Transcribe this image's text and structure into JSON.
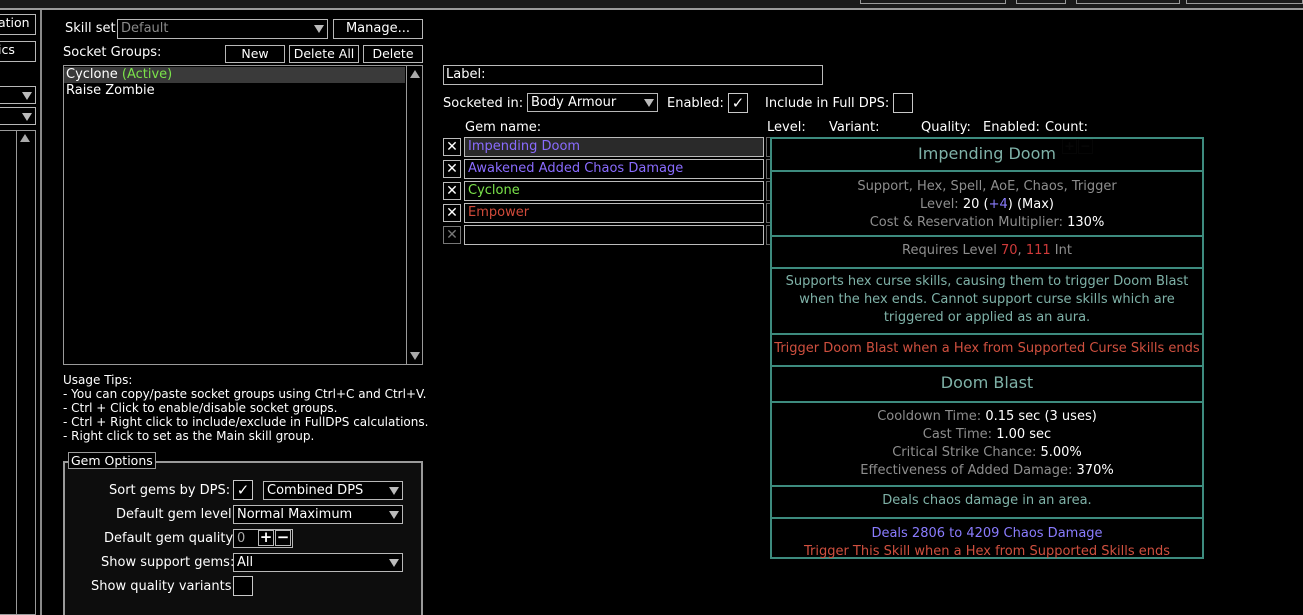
{
  "left_partial": {
    "items": [
      "ation",
      "ics"
    ]
  },
  "skill_set": {
    "label": "Skill set:",
    "value": "Default",
    "manage_button": "Manage..."
  },
  "socket_groups": {
    "label": "Socket Groups:",
    "new_button": "New",
    "delete_all_button": "Delete All",
    "delete_button": "Delete",
    "groups": [
      {
        "name": "Cyclone",
        "status": "(Active)"
      },
      {
        "name": "Raise Zombie",
        "status": ""
      }
    ]
  },
  "usage_tips": {
    "title": "Usage Tips:",
    "lines": [
      "- You can copy/paste socket groups using Ctrl+C and Ctrl+V.",
      "- Ctrl + Click to enable/disable socket groups.",
      "- Ctrl + Right click to include/exclude in FullDPS calculations.",
      "- Right click to set as the Main skill group."
    ]
  },
  "gem_options": {
    "title": "Gem Options",
    "sort_label": "Sort gems by DPS:",
    "sort_checked": "✓",
    "sort_mode": "Combined DPS",
    "default_level_label": "Default gem level:",
    "default_level": "Normal Maximum",
    "default_quality_label": "Default gem quality:",
    "default_quality": "0",
    "show_support_label": "Show support gems:",
    "show_support": "All",
    "show_quality_label": "Show quality variants:"
  },
  "group_editor": {
    "label_field": "Label:",
    "socketed_in_label": "Socketed in:",
    "socketed_in": "Body Armour",
    "enabled_label": "Enabled:",
    "enabled_checked": "✓",
    "full_dps_label": "Include in Full DPS:",
    "col_gem_name": "Gem name:",
    "col_level": "Level:",
    "col_variant": "Variant:",
    "col_quality": "Quality:",
    "col_enabled": "Enabled:",
    "col_count": "Count:",
    "gems": [
      {
        "name": "Impending Doom",
        "color": "#8a6cff"
      },
      {
        "name": "Awakened Added Chaos Damage",
        "color": "#8a6cff"
      },
      {
        "name": "Cyclone",
        "color": "#7be34a"
      },
      {
        "name": "Empower",
        "color": "#d04a3a"
      },
      {
        "name": "",
        "color": "#ffffff"
      }
    ]
  },
  "tooltip": {
    "gem_name": "Impending Doom",
    "tags": "Support, Hex, Spell, AoE, Chaos, Trigger",
    "level_label": "Level:",
    "level_value": "20",
    "level_bonus": "+4",
    "level_max": "(Max)",
    "cost_label": "Cost & Reservation Multiplier:",
    "cost_value": "130%",
    "requires_label": "Requires Level",
    "requires_level": "70",
    "requires_int": "111",
    "requires_int_label": "Int",
    "description": "Supports hex curse skills, causing them to trigger Doom Blast when the hex ends. Cannot support curse skills which are triggered or applied as an aura.",
    "trigger_text": "Trigger Doom Blast when a Hex from Supported Curse Skills ends",
    "sub_skill_name": "Doom Blast",
    "cooldown_label": "Cooldown Time:",
    "cooldown_value": "0.15 sec (3 uses)",
    "cast_label": "Cast Time:",
    "cast_value": "1.00 sec",
    "crit_label": "Critical Strike Chance:",
    "crit_value": "5.00%",
    "effect_label": "Effectiveness of Added Damage:",
    "effect_value": "370%",
    "sub_description": "Deals chaos damage in an area.",
    "damage_text": "Deals 2806 to 4209 Chaos Damage",
    "trigger2_text": "Trigger This Skill when a Hex from Supported Skills ends"
  },
  "colors": {
    "accent_teal": "#3d8b7e",
    "gem_int": "#8a6cff",
    "gem_dex": "#7be34a",
    "gem_str": "#d04a3a",
    "requirement_red": "#d03a3a"
  }
}
